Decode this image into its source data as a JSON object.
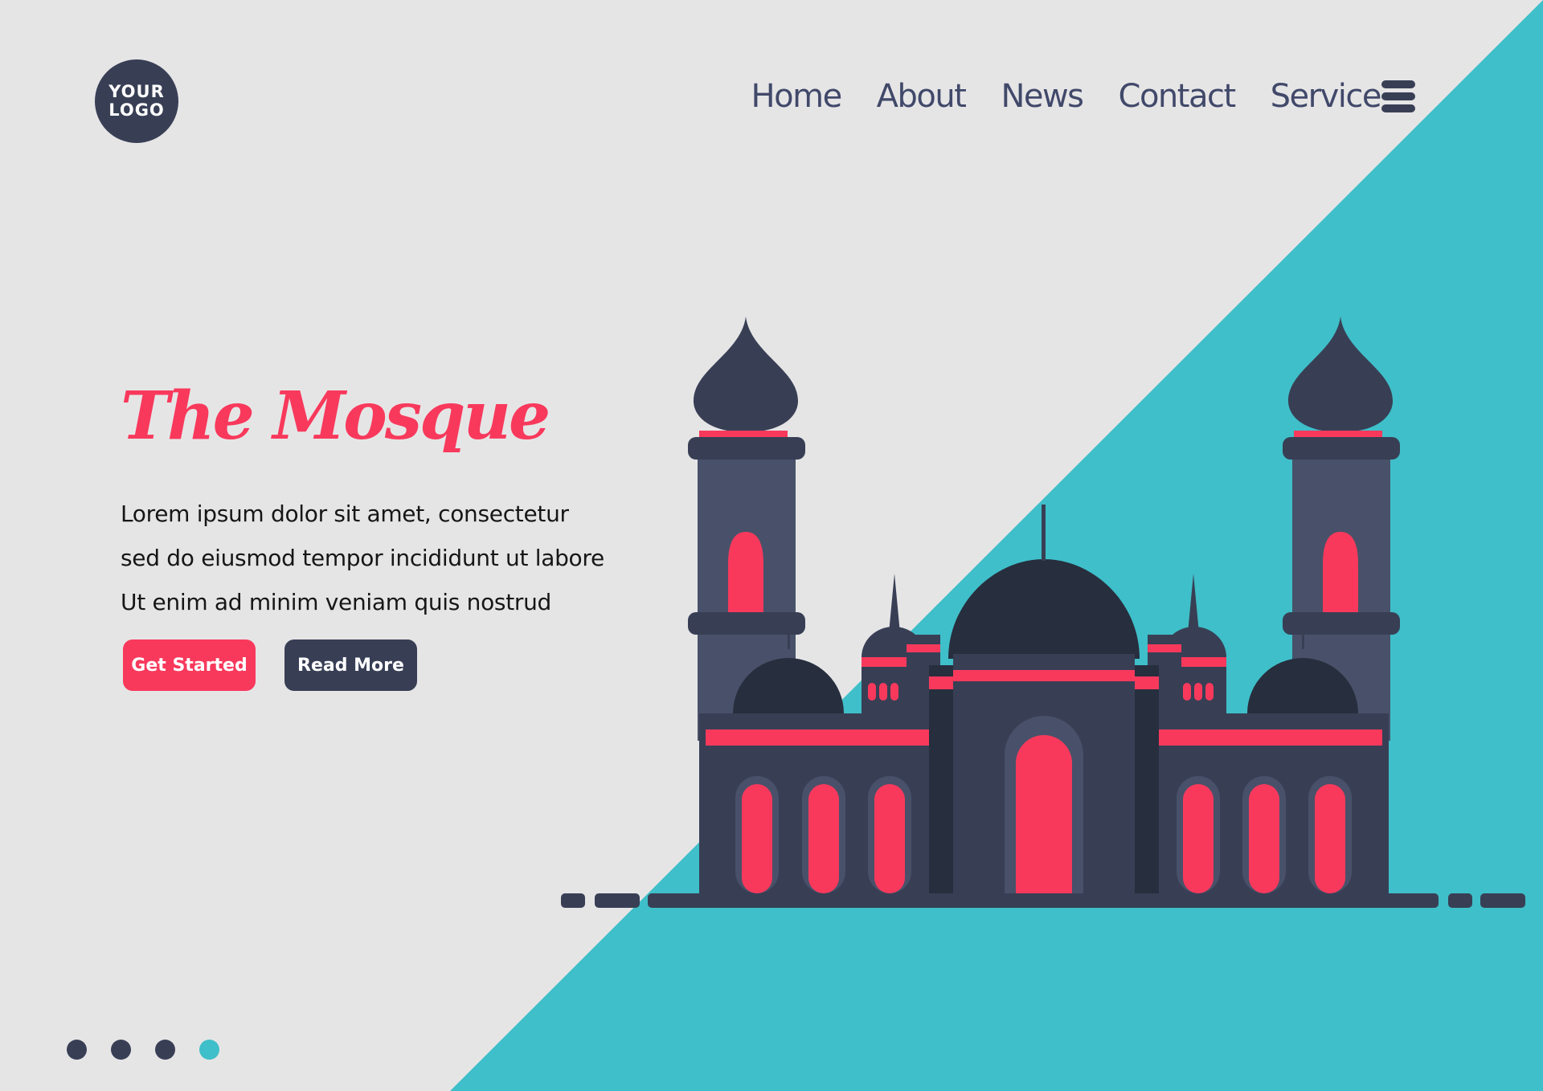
{
  "logo": {
    "line1": "YOUR",
    "line2": "LOGO"
  },
  "nav": {
    "items": [
      "Home",
      "About",
      "News",
      "Contact",
      "Service"
    ]
  },
  "menu_icon": "hamburger-menu-icon",
  "hero": {
    "title": "The Mosque",
    "lines": [
      "Lorem ipsum dolor sit amet, consectetur",
      "sed do eiusmod tempor incididunt ut labore",
      "Ut enim ad minim veniam quis nostrud"
    ],
    "primary_button": "Get Started",
    "secondary_button": "Read More"
  },
  "pagination": {
    "total": 4,
    "active_index": 3
  },
  "colors": {
    "background": "#e6e5e6",
    "accent_teal": "#3fbfc9",
    "accent_red": "#f8395c",
    "dark_navy": "#383f55"
  }
}
